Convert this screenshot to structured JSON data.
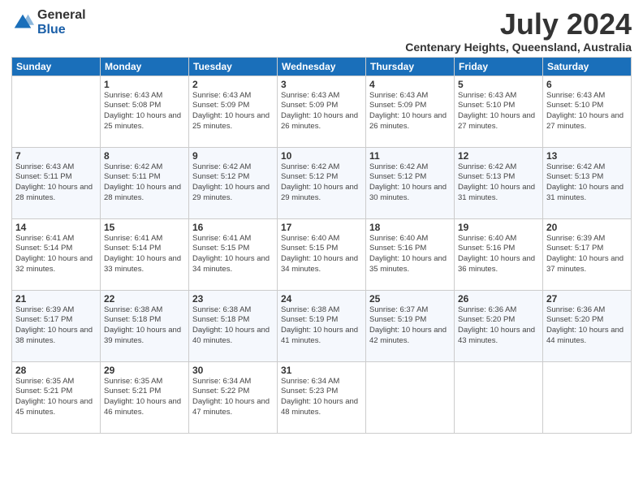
{
  "header": {
    "logo_general": "General",
    "logo_blue": "Blue",
    "month_year": "July 2024",
    "location": "Centenary Heights, Queensland, Australia"
  },
  "days_of_week": [
    "Sunday",
    "Monday",
    "Tuesday",
    "Wednesday",
    "Thursday",
    "Friday",
    "Saturday"
  ],
  "weeks": [
    [
      {
        "day": "",
        "info": ""
      },
      {
        "day": "1",
        "info": "Sunrise: 6:43 AM\nSunset: 5:08 PM\nDaylight: 10 hours\nand 25 minutes."
      },
      {
        "day": "2",
        "info": "Sunrise: 6:43 AM\nSunset: 5:09 PM\nDaylight: 10 hours\nand 25 minutes."
      },
      {
        "day": "3",
        "info": "Sunrise: 6:43 AM\nSunset: 5:09 PM\nDaylight: 10 hours\nand 26 minutes."
      },
      {
        "day": "4",
        "info": "Sunrise: 6:43 AM\nSunset: 5:09 PM\nDaylight: 10 hours\nand 26 minutes."
      },
      {
        "day": "5",
        "info": "Sunrise: 6:43 AM\nSunset: 5:10 PM\nDaylight: 10 hours\nand 27 minutes."
      },
      {
        "day": "6",
        "info": "Sunrise: 6:43 AM\nSunset: 5:10 PM\nDaylight: 10 hours\nand 27 minutes."
      }
    ],
    [
      {
        "day": "7",
        "info": "Sunrise: 6:43 AM\nSunset: 5:11 PM\nDaylight: 10 hours\nand 28 minutes."
      },
      {
        "day": "8",
        "info": "Sunrise: 6:42 AM\nSunset: 5:11 PM\nDaylight: 10 hours\nand 28 minutes."
      },
      {
        "day": "9",
        "info": "Sunrise: 6:42 AM\nSunset: 5:12 PM\nDaylight: 10 hours\nand 29 minutes."
      },
      {
        "day": "10",
        "info": "Sunrise: 6:42 AM\nSunset: 5:12 PM\nDaylight: 10 hours\nand 29 minutes."
      },
      {
        "day": "11",
        "info": "Sunrise: 6:42 AM\nSunset: 5:12 PM\nDaylight: 10 hours\nand 30 minutes."
      },
      {
        "day": "12",
        "info": "Sunrise: 6:42 AM\nSunset: 5:13 PM\nDaylight: 10 hours\nand 31 minutes."
      },
      {
        "day": "13",
        "info": "Sunrise: 6:42 AM\nSunset: 5:13 PM\nDaylight: 10 hours\nand 31 minutes."
      }
    ],
    [
      {
        "day": "14",
        "info": "Sunrise: 6:41 AM\nSunset: 5:14 PM\nDaylight: 10 hours\nand 32 minutes."
      },
      {
        "day": "15",
        "info": "Sunrise: 6:41 AM\nSunset: 5:14 PM\nDaylight: 10 hours\nand 33 minutes."
      },
      {
        "day": "16",
        "info": "Sunrise: 6:41 AM\nSunset: 5:15 PM\nDaylight: 10 hours\nand 34 minutes."
      },
      {
        "day": "17",
        "info": "Sunrise: 6:40 AM\nSunset: 5:15 PM\nDaylight: 10 hours\nand 34 minutes."
      },
      {
        "day": "18",
        "info": "Sunrise: 6:40 AM\nSunset: 5:16 PM\nDaylight: 10 hours\nand 35 minutes."
      },
      {
        "day": "19",
        "info": "Sunrise: 6:40 AM\nSunset: 5:16 PM\nDaylight: 10 hours\nand 36 minutes."
      },
      {
        "day": "20",
        "info": "Sunrise: 6:39 AM\nSunset: 5:17 PM\nDaylight: 10 hours\nand 37 minutes."
      }
    ],
    [
      {
        "day": "21",
        "info": "Sunrise: 6:39 AM\nSunset: 5:17 PM\nDaylight: 10 hours\nand 38 minutes."
      },
      {
        "day": "22",
        "info": "Sunrise: 6:38 AM\nSunset: 5:18 PM\nDaylight: 10 hours\nand 39 minutes."
      },
      {
        "day": "23",
        "info": "Sunrise: 6:38 AM\nSunset: 5:18 PM\nDaylight: 10 hours\nand 40 minutes."
      },
      {
        "day": "24",
        "info": "Sunrise: 6:38 AM\nSunset: 5:19 PM\nDaylight: 10 hours\nand 41 minutes."
      },
      {
        "day": "25",
        "info": "Sunrise: 6:37 AM\nSunset: 5:19 PM\nDaylight: 10 hours\nand 42 minutes."
      },
      {
        "day": "26",
        "info": "Sunrise: 6:36 AM\nSunset: 5:20 PM\nDaylight: 10 hours\nand 43 minutes."
      },
      {
        "day": "27",
        "info": "Sunrise: 6:36 AM\nSunset: 5:20 PM\nDaylight: 10 hours\nand 44 minutes."
      }
    ],
    [
      {
        "day": "28",
        "info": "Sunrise: 6:35 AM\nSunset: 5:21 PM\nDaylight: 10 hours\nand 45 minutes."
      },
      {
        "day": "29",
        "info": "Sunrise: 6:35 AM\nSunset: 5:21 PM\nDaylight: 10 hours\nand 46 minutes."
      },
      {
        "day": "30",
        "info": "Sunrise: 6:34 AM\nSunset: 5:22 PM\nDaylight: 10 hours\nand 47 minutes."
      },
      {
        "day": "31",
        "info": "Sunrise: 6:34 AM\nSunset: 5:23 PM\nDaylight: 10 hours\nand 48 minutes."
      },
      {
        "day": "",
        "info": ""
      },
      {
        "day": "",
        "info": ""
      },
      {
        "day": "",
        "info": ""
      }
    ]
  ]
}
